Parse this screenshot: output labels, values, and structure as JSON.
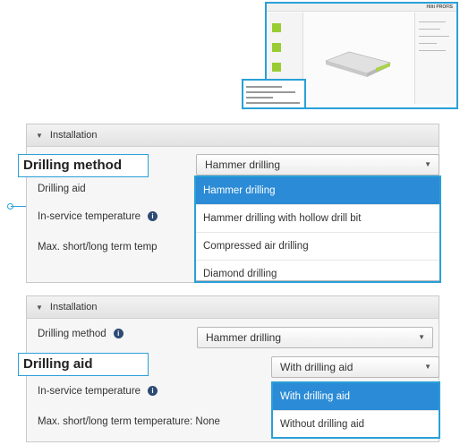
{
  "thumbnail": {
    "logo": "Hilti PROFIS"
  },
  "panel1": {
    "header": "Installation",
    "callout": "Drilling method",
    "rows": [
      "Drilling aid",
      "In-service temperature",
      "Max. short/long term temp"
    ],
    "select_value": "Hammer drilling",
    "options": [
      "Hammer drilling",
      "Hammer drilling with hollow drill bit",
      "Compressed air drilling",
      "Diamond drilling"
    ]
  },
  "panel2": {
    "header": "Installation",
    "row_drilling_method": "Drilling method",
    "method_value": "Hammer drilling",
    "callout": "Drilling aid",
    "rows": [
      "In-service temperature",
      "Max. short/long term temperature: None"
    ],
    "select_value": "With drilling aid",
    "options": [
      "With drilling aid",
      "Without drilling aid"
    ]
  },
  "icons": {
    "info": "i",
    "collapse": "▼",
    "dropdown_arrow": "▼"
  },
  "colors": {
    "accent": "#2aa0d8",
    "selected": "#2b8bd6"
  }
}
